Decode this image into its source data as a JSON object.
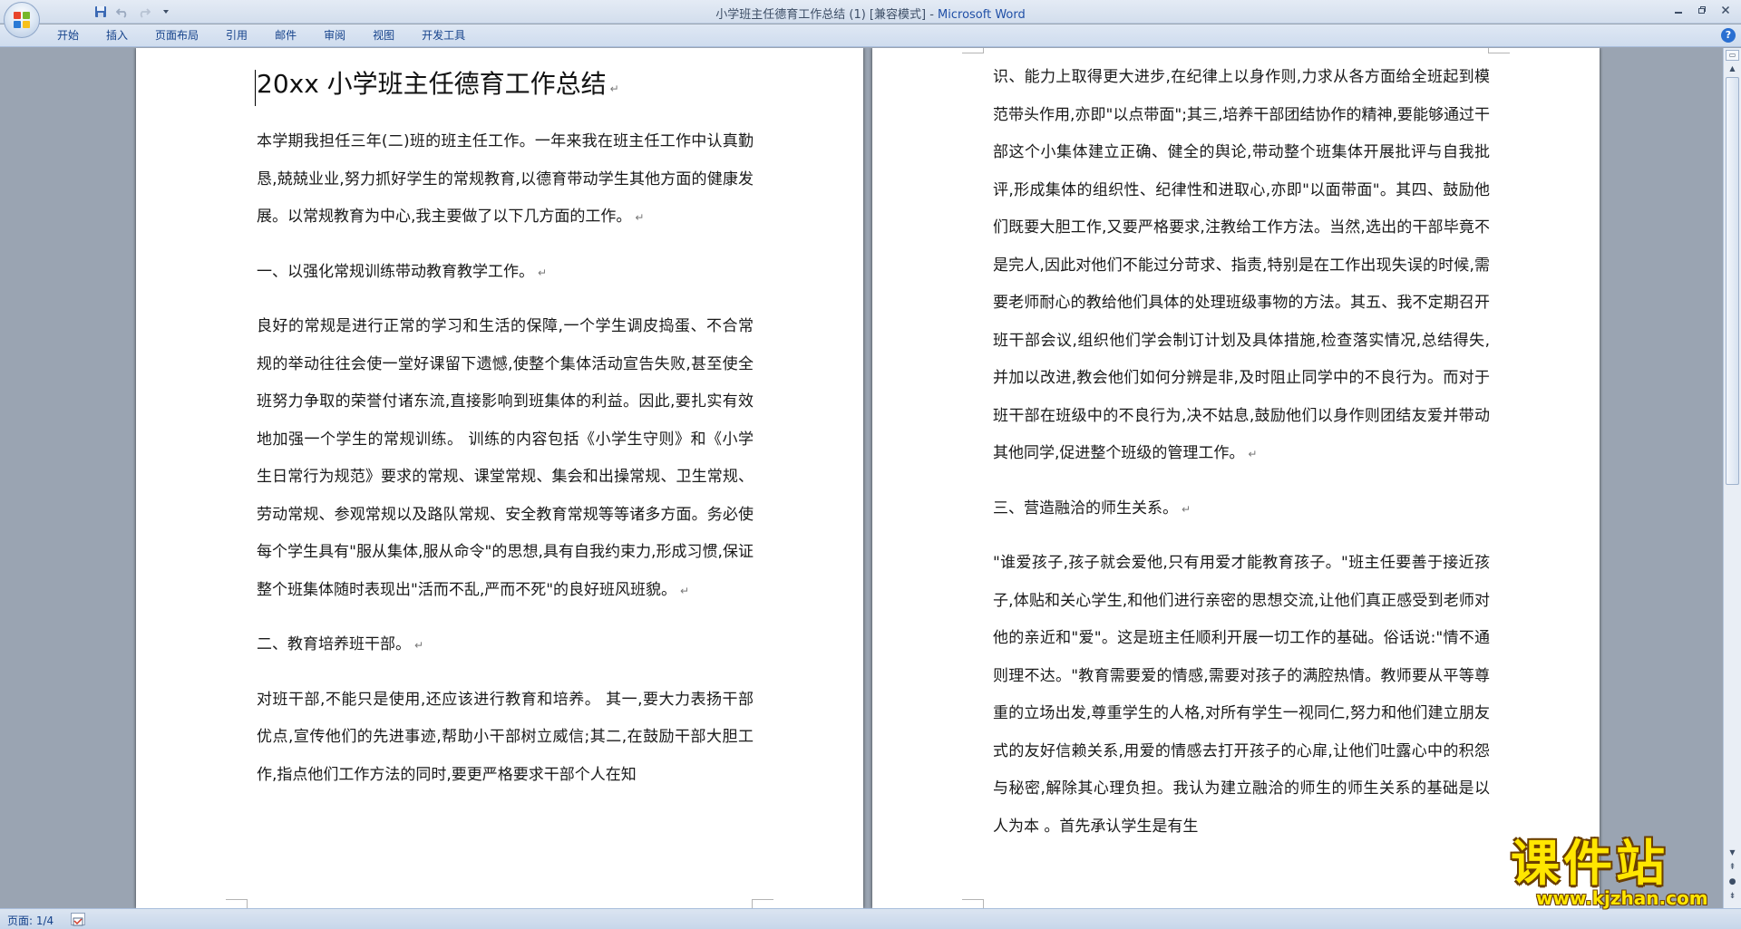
{
  "window": {
    "title": "小学班主任德育工作总结 (1) [兼容模式]",
    "title_sep": " - ",
    "app_name": "Microsoft Word"
  },
  "ribbon": {
    "tabs": [
      "开始",
      "插入",
      "页面布局",
      "引用",
      "邮件",
      "审阅",
      "视图",
      "开发工具"
    ]
  },
  "document": {
    "title": "20xx 小学班主任德育工作总结",
    "page1_paragraphs": [
      "本学期我担任三年(二)班的班主任工作。一年来我在班主任工作中认真勤恳,兢兢业业,努力抓好学生的常规教育,以德育带动学生其他方面的健康发展。以常规教育为中心,我主要做了以下几方面的工作。",
      "一、以强化常规训练带动教育教学工作。",
      "良好的常规是进行正常的学习和生活的保障,一个学生调皮捣蛋、不合常规的举动往往会使一堂好课留下遗憾,使整个集体活动宣告失败,甚至使全班努力争取的荣誉付诸东流,直接影响到班集体的利益。因此,要扎实有效地加强一个学生的常规训练。 训练的内容包括《小学生守则》和《小学生日常行为规范》要求的常规、课堂常规、集会和出操常规、卫生常规、劳动常规、参观常规以及路队常规、安全教育常规等等诸多方面。务必使每个学生具有\"服从集体,服从命令\"的思想,具有自我约束力,形成习惯,保证整个班集体随时表现出\"活而不乱,严而不死\"的良好班风班貌。",
      "二、教育培养班干部。",
      "对班干部,不能只是使用,还应该进行教育和培养。 其一,要大力表扬干部优点,宣传他们的先进事迹,帮助小干部树立威信;其二,在鼓励干部大胆工作,指点他们工作方法的同时,要更严格要求干部个人在知"
    ],
    "page2_paragraphs": [
      "识、能力上取得更大进步,在纪律上以身作则,力求从各方面给全班起到模范带头作用,亦即\"以点带面\";其三,培养干部团结协作的精神,要能够通过干部这个小集体建立正确、健全的舆论,带动整个班集体开展批评与自我批评,形成集体的组织性、纪律性和进取心,亦即\"以面带面\"。其四、鼓励他们既要大胆工作,又要严格要求,注教给工作方法。当然,选出的干部毕竟不是完人,因此对他们不能过分苛求、指责,特别是在工作出现失误的时候,需要老师耐心的教给他们具体的处理班级事物的方法。其五、我不定期召开班干部会议,组织他们学会制订计划及具体措施,检查落实情况,总结得失,并加以改进,教会他们如何分辨是非,及时阻止同学中的不良行为。而对于班干部在班级中的不良行为,决不姑息,鼓励他们以身作则团结友爱并带动其他同学,促进整个班级的管理工作。",
      "三、营造融洽的师生关系。",
      "\"谁爱孩子,孩子就会爱他,只有用爱才能教育孩子。\"班主任要善于接近孩子,体贴和关心学生,和他们进行亲密的思想交流,让他们真正感受到老师对他的亲近和\"爱\"。这是班主任顺利开展一切工作的基础。俗话说:\"情不通则理不达。\"教育需要爱的情感,需要对孩子的满腔热情。教师要从平等尊重的立场出发,尊重学生的人格,对所有学生一视同仁,努力和他们建立朋友式的友好信赖关系,用爱的情感去打开孩子的心扉,让他们吐露心中的积怨与秘密,解除其心理负担。我认为建立融洽的师生的师生关系的基础是以人为本 。首先承认学生是有生"
    ],
    "paragraph_mark": "↵"
  },
  "statusbar": {
    "page_info": "页面: 1/4"
  },
  "watermark": {
    "text": "课件站",
    "url": "www.kjzhan.com"
  },
  "colors": {
    "ribbon_text": "#15428b",
    "app_name": "#1f4fa6",
    "background": "#9aa4b2"
  }
}
